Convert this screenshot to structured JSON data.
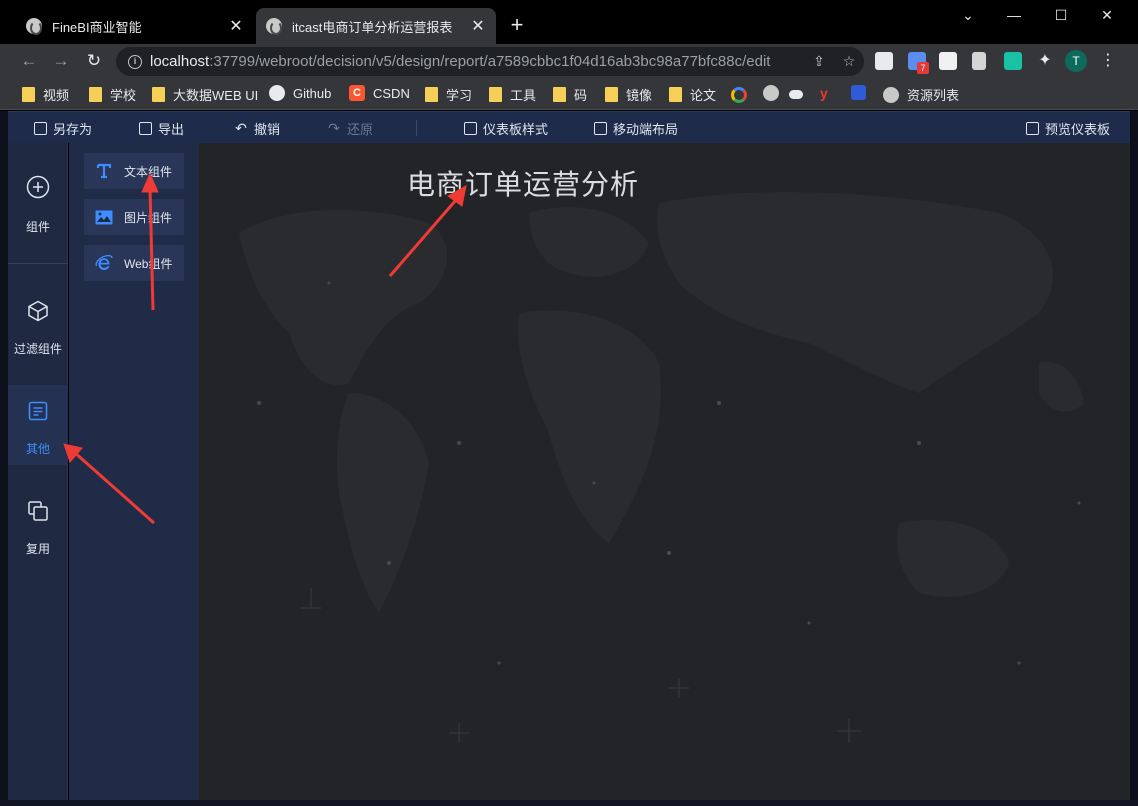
{
  "browser": {
    "tabs": [
      {
        "title": "FineBI商业智能",
        "active": false
      },
      {
        "title": "itcast电商订单分析运营报表",
        "active": true
      }
    ],
    "new_tab": "+",
    "window_controls": {
      "minimize": "⌄",
      "min": "—",
      "max": "☐",
      "close": "✕"
    },
    "url_host": "localhost",
    "url_rest": ":37799/webroot/decision/v5/design/report/a7589cbbc1f04d16ab3bc98a77bfc88c/edit",
    "profile_initial": "T",
    "extension_badge": "7"
  },
  "bookmarks": [
    {
      "label": "视频",
      "icon": "folder-icon"
    },
    {
      "label": "学校",
      "icon": "folder-icon"
    },
    {
      "label": "大数据WEB UI",
      "icon": "folder-icon"
    },
    {
      "label": "Github",
      "icon": "github-icon"
    },
    {
      "label": "CSDN",
      "icon": "csdn-icon"
    },
    {
      "label": "学习",
      "icon": "folder-icon"
    },
    {
      "label": "工具",
      "icon": "folder-icon"
    },
    {
      "label": "码",
      "icon": "folder-icon"
    },
    {
      "label": "镜像",
      "icon": "folder-icon"
    },
    {
      "label": "论文",
      "icon": "folder-icon"
    },
    {
      "label": "资源列表",
      "icon": "globe-icon"
    }
  ],
  "app_toolbar": {
    "save_as": "另存为",
    "export": "导出",
    "undo": "撤销",
    "redo": "还原",
    "dashboard_style": "仪表板样式",
    "mobile_layout": "移动端布局",
    "preview": "预览仪表板"
  },
  "left_rail": {
    "components": "组件",
    "filter_components": "过滤组件",
    "other": "其他",
    "reuse": "复用"
  },
  "component_panel": {
    "text": "文本组件",
    "image": "图片组件",
    "web": "Web组件"
  },
  "canvas": {
    "title": "电商订单运营分析"
  },
  "colors": {
    "accent": "#3e8cff",
    "annotation_arrow": "#ee3b36",
    "toolbar_bg": "#1e2b4a",
    "canvas_bg": "#232427"
  }
}
